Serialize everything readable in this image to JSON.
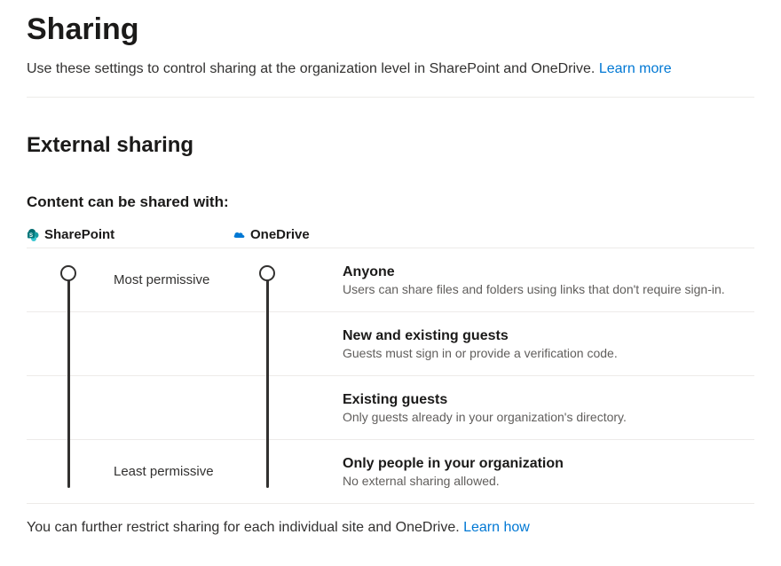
{
  "page": {
    "title": "Sharing",
    "subtitle_prefix": "Use these settings to control sharing at the organization level in SharePoint and OneDrive. ",
    "learn_more": "Learn more"
  },
  "external": {
    "heading": "External sharing",
    "content_label": "Content can be shared with:",
    "products": {
      "sharepoint": "SharePoint",
      "onedrive": "OneDrive"
    },
    "scale": {
      "most": "Most permissive",
      "least": "Least permissive"
    },
    "levels": [
      {
        "title": "Anyone",
        "desc": "Users can share files and folders using links that don't require sign-in."
      },
      {
        "title": "New and existing guests",
        "desc": "Guests must sign in or provide a verification code."
      },
      {
        "title": "Existing guests",
        "desc": "Only guests already in your organization's directory."
      },
      {
        "title": "Only people in your organization",
        "desc": "No external sharing allowed."
      }
    ],
    "footer_prefix": "You can further restrict sharing for each individual site and OneDrive. ",
    "learn_how": "Learn how"
  }
}
